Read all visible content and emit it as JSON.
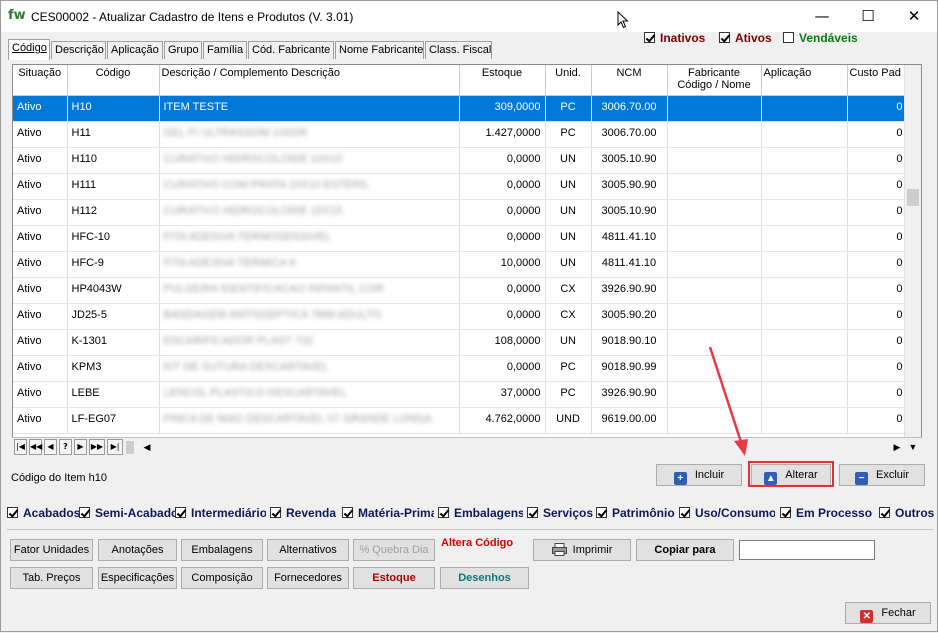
{
  "window": {
    "app_logo": "fw",
    "title": "CES00002 - Atualizar Cadastro de Itens e Produtos  (V. 3.01)",
    "minimize": "—",
    "maximize": "☐",
    "close": "✕"
  },
  "tabs": [
    {
      "label": "Código"
    },
    {
      "label": "Descrição"
    },
    {
      "label": "Aplicação"
    },
    {
      "label": "Grupo"
    },
    {
      "label": "Família"
    },
    {
      "label": "Cód. Fabricante"
    },
    {
      "label": "Nome Fabricante"
    },
    {
      "label": "Class. Fiscal"
    }
  ],
  "status_filters": [
    {
      "label": "Inativos",
      "checked": true,
      "color": "#7a0000"
    },
    {
      "label": "Ativos",
      "checked": true,
      "color": "#7a0000"
    },
    {
      "label": "Vendáveis",
      "checked": false,
      "color": "#0b7a12"
    }
  ],
  "grid": {
    "columns": [
      "Situação",
      "Código",
      "Descrição / Complemento Descrição",
      "Estoque",
      "Unid.",
      "NCM",
      "Fabricante Código / Nome",
      "Aplicação",
      "Custo Pad"
    ],
    "rows": [
      {
        "situacao": "Ativo",
        "codigo": "H10",
        "descricao": "ITEM TESTE",
        "estoque": "309,0000",
        "unid": "PC",
        "ncm": "3006.70.00",
        "custo": "0",
        "selected": true
      },
      {
        "situacao": "Ativo",
        "codigo": "H11",
        "descricao": "GEL P/ ULTRASSOM 100GR",
        "estoque": "1.427,0000",
        "unid": "PC",
        "ncm": "3006.70.00",
        "custo": "0"
      },
      {
        "situacao": "Ativo",
        "codigo": "H110",
        "descricao": "CURATIVO HIDROCOLOIDE 10X10",
        "estoque": "0,0000",
        "unid": "UN",
        "ncm": "3005.10.90",
        "custo": "0"
      },
      {
        "situacao": "Ativo",
        "codigo": "H111",
        "descricao": "CURATIVO COM PRATA 10X10 ESTERIL",
        "estoque": "0,0000",
        "unid": "UN",
        "ncm": "3005.90.90",
        "custo": "0"
      },
      {
        "situacao": "Ativo",
        "codigo": "H112",
        "descricao": "CURATIVO HIDROCOLOIDE 15X15",
        "estoque": "0,0000",
        "unid": "UN",
        "ncm": "3005.10.90",
        "custo": "0"
      },
      {
        "situacao": "Ativo",
        "codigo": "HFC-10",
        "descricao": "FITA ADESIVA TERMOSENSIVEL",
        "estoque": "0,0000",
        "unid": "UN",
        "ncm": "4811.41.10",
        "custo": "0"
      },
      {
        "situacao": "Ativo",
        "codigo": "HFC-9",
        "descricao": "FITA ADESIVA TERMICA 9",
        "estoque": "10,0000",
        "unid": "UN",
        "ncm": "4811.41.10",
        "custo": "0"
      },
      {
        "situacao": "Ativo",
        "codigo": "HP4043W",
        "descricao": "PULSEIRA IDENTIFICACAO INFANTIL COR",
        "estoque": "0,0000",
        "unid": "CX",
        "ncm": "3926.90.90",
        "custo": "0"
      },
      {
        "situacao": "Ativo",
        "codigo": "JD25-5",
        "descricao": "BANDAGEM ANTISSEPTICA 7MM ADULTO",
        "estoque": "0,0000",
        "unid": "CX",
        "ncm": "3005.90.20",
        "custo": "0"
      },
      {
        "situacao": "Ativo",
        "codigo": "K-1301",
        "descricao": "ESCARIFICADOR PLAST 702",
        "estoque": "108,0000",
        "unid": "UN",
        "ncm": "9018.90.10",
        "custo": "0"
      },
      {
        "situacao": "Ativo",
        "codigo": "KPM3",
        "descricao": "KIT DE SUTURA DESCARTAVEL",
        "estoque": "0,0000",
        "unid": "PC",
        "ncm": "9018.90.99",
        "custo": "0"
      },
      {
        "situacao": "Ativo",
        "codigo": "LEBE",
        "descricao": "LENCOL PLASTICO DESCARTAVEL",
        "estoque": "37,0000",
        "unid": "PC",
        "ncm": "3926.90.90",
        "custo": "0"
      },
      {
        "situacao": "Ativo",
        "codigo": "LF-EG07",
        "descricao": "PINCA DE MAO DESCARTAVEL 07 GRANDE LONGA",
        "estoque": "4.762,0000",
        "unid": "UND",
        "ncm": "9619.00.00",
        "custo": "0"
      }
    ]
  },
  "navigator": [
    "|◀",
    "◀◀",
    "◀",
    "?",
    "▶",
    "▶▶",
    "▶|"
  ],
  "item_code_label": "Código do Item  h10",
  "actions": {
    "incluir": "Incluir",
    "alterar": "Alterar",
    "excluir": "Excluir"
  },
  "categories": [
    {
      "label": "Acabados",
      "checked": true
    },
    {
      "label": "Semi-Acabados",
      "checked": true
    },
    {
      "label": "Intermediários",
      "checked": true
    },
    {
      "label": "Revenda",
      "checked": true
    },
    {
      "label": "Matéria-Prima",
      "checked": true
    },
    {
      "label": "Embalagens",
      "checked": true
    },
    {
      "label": "Serviços",
      "checked": true
    },
    {
      "label": "Patrimônio",
      "checked": true
    },
    {
      "label": "Uso/Consumo",
      "checked": true
    },
    {
      "label": "Em Processo",
      "checked": true
    },
    {
      "label": "Outros",
      "checked": true
    }
  ],
  "footer": {
    "fator_unidades": "Fator Unidades",
    "anotacoes": "Anotações",
    "embalagens": "Embalagens",
    "alternativos": "Alternativos",
    "quebra_dia": "% Quebra Dia",
    "altera_codigo": "Altera Código",
    "imprimir": "Imprimir",
    "copiar_para": "Copiar para",
    "copiar_para_value": "",
    "tab_precos": "Tab. Preços",
    "especificacoes": "Especificações",
    "composicao": "Composição",
    "fornecedores": "Fornecedores",
    "estoque": "Estoque",
    "desenhos": "Desenhos",
    "fechar": "Fechar"
  }
}
